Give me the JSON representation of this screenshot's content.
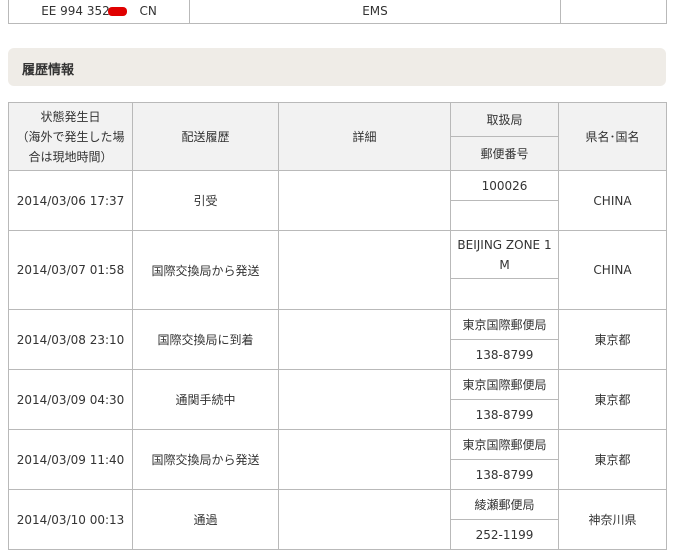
{
  "top_row": {
    "tracking_prefix": "EE 994 352",
    "tracking_suffix": "CN",
    "service": "EMS"
  },
  "history": {
    "title": "履歴情報",
    "headers": {
      "date_line1": "状態発生日",
      "date_line2": "（海外で発生した場",
      "date_line3": "合は現地時間）",
      "status": "配送履歴",
      "detail": "詳細",
      "office": "取扱局",
      "postal": "郵便番号",
      "region": "県名･国名"
    },
    "rows": [
      {
        "date": "2014/03/06 17:37",
        "status": "引受",
        "detail": "",
        "office": "100026",
        "postal": "",
        "region": "CHINA"
      },
      {
        "date": "2014/03/07 01:58",
        "status": "国際交換局から発送",
        "detail": "",
        "office": "BEIJING ZONE 1 M",
        "postal": "",
        "region": "CHINA"
      },
      {
        "date": "2014/03/08 23:10",
        "status": "国際交換局に到着",
        "detail": "",
        "office": "東京国際郵便局",
        "postal": "138-8799",
        "region": "東京都"
      },
      {
        "date": "2014/03/09 04:30",
        "status": "通関手続中",
        "detail": "",
        "office": "東京国際郵便局",
        "postal": "138-8799",
        "region": "東京都"
      },
      {
        "date": "2014/03/09 11:40",
        "status": "国際交換局から発送",
        "detail": "",
        "office": "東京国際郵便局",
        "postal": "138-8799",
        "region": "東京都"
      },
      {
        "date": "2014/03/10 00:13",
        "status": "通過",
        "detail": "",
        "office": "綾瀬郵便局",
        "postal": "252-1199",
        "region": "神奈川県"
      }
    ]
  }
}
